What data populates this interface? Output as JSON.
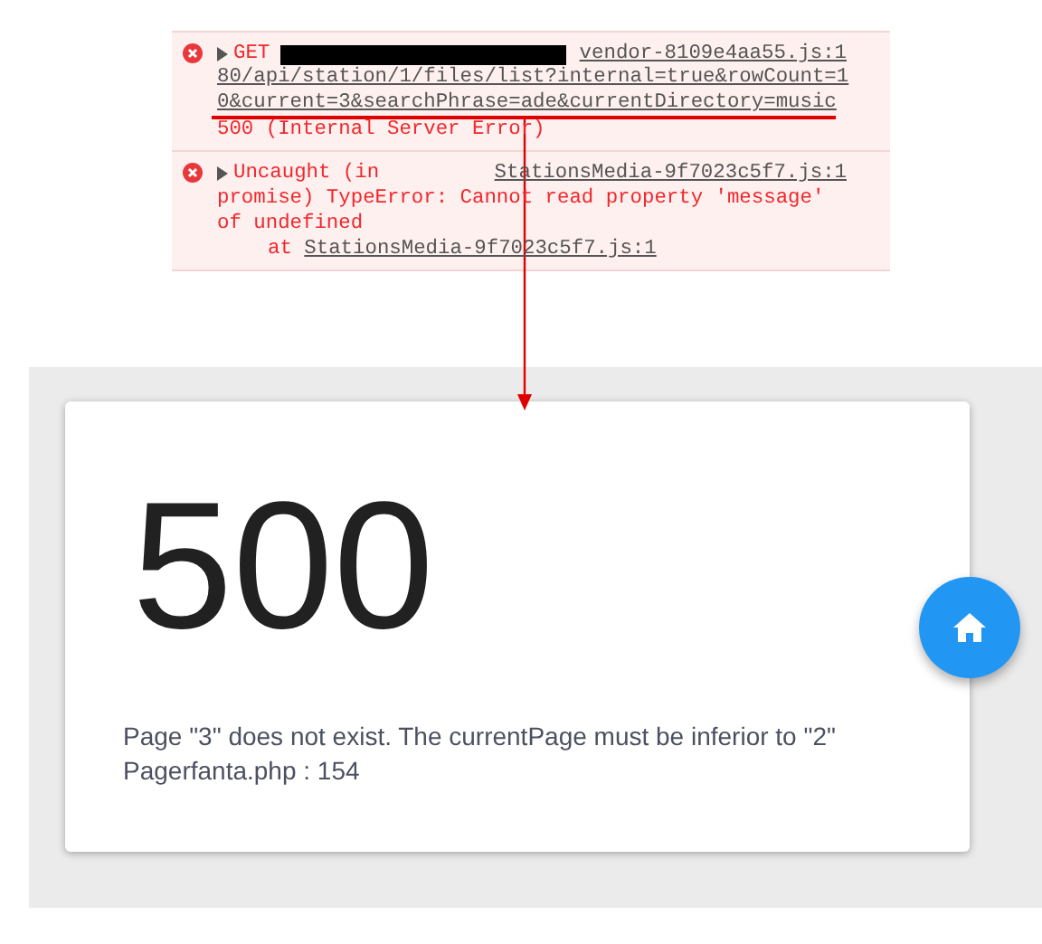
{
  "console": {
    "messages": [
      {
        "kind": "error",
        "method": "GET",
        "source": "vendor-8109e4aa55.js:1",
        "url_lines": [
          "80/api/station/1/files/list?internal=true&rowCount=1",
          "0&current=3&searchPhrase=ade&currentDirectory=music"
        ],
        "lines": [
          "500 (Internal Server Error)"
        ],
        "redacted": true
      },
      {
        "kind": "error",
        "head": "Uncaught (in",
        "source": "StationsMedia-9f7023c5f7.js:1",
        "lines": [
          "promise) TypeError: Cannot read property 'message'",
          "of undefined"
        ],
        "stack": [
          {
            "at": "at",
            "link": "StationsMedia-9f7023c5f7.js:1"
          }
        ]
      }
    ]
  },
  "error_page": {
    "code": "500",
    "message": "Page \"3\" does not exist. The currentPage must be inferior to \"2\"",
    "location": "Pagerfanta.php : 154"
  }
}
